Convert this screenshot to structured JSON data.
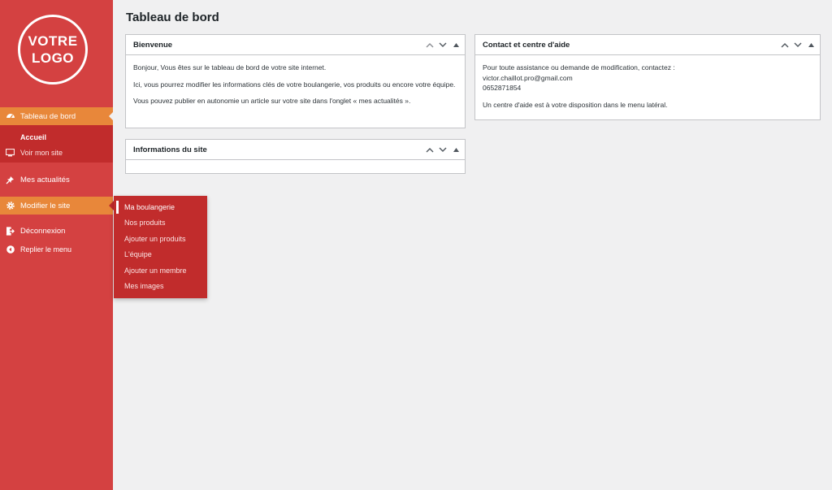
{
  "logo": {
    "line1": "VOTRE",
    "line2": "LOGO"
  },
  "sidebar": {
    "dashboard_label": "Tableau de bord",
    "sub_home": "Accueil",
    "sub_view_site": "Voir mon site",
    "news_label": "Mes actualités",
    "edit_site_label": "Modifier le site",
    "logout_label": "Déconnexion",
    "collapse_label": "Replier le menu"
  },
  "flyout": {
    "items": [
      "Ma boulangerie",
      "Nos produits",
      "Ajouter un produits",
      "L'équipe",
      "Ajouter un membre",
      "Mes images"
    ]
  },
  "page": {
    "title": "Tableau de bord"
  },
  "welcome": {
    "title": "Bienvenue",
    "p1": "Bonjour, Vous êtes sur le tableau de bord de votre site internet.",
    "p2": "Ici, vous pourrez modifier les informations clés de votre boulangerie, vos produits ou encore votre équipe.",
    "p3": "Vous pouvez publier en autonomie un article sur votre site dans l'onglet « mes actualités »."
  },
  "site_info": {
    "title": "Informations du site"
  },
  "contact": {
    "title": "Contact et centre d'aide",
    "line1": "Pour toute assistance ou demande de modification, contactez :",
    "email": "victor.chaillot.pro@gmail.com",
    "phone": "0652871854",
    "help": "Un centre d'aide est à votre disposition dans le menu latéral."
  },
  "colors": {
    "sidebar": "#d44141",
    "active": "#e8873a",
    "submenu": "#c12c2c",
    "background": "#f0f0f1"
  },
  "icons": [
    "dashboard-icon",
    "monitor-icon",
    "pin-icon",
    "gear-icon",
    "logout-icon",
    "collapse-icon",
    "chevron-up-icon",
    "chevron-down-icon",
    "triangle-up-icon"
  ]
}
